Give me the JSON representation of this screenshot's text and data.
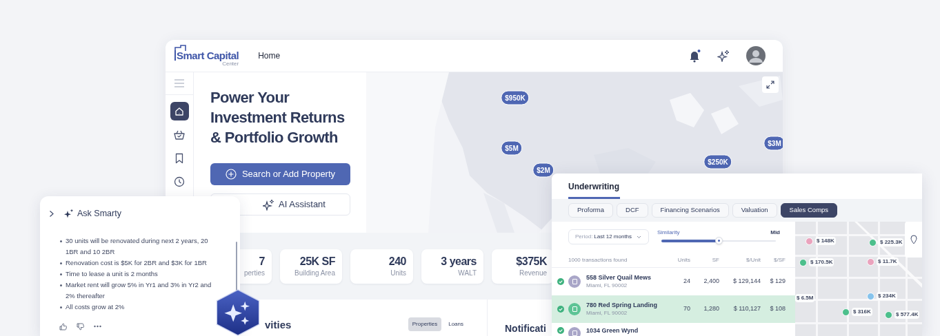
{
  "app": {
    "logo": {
      "name": "Smart Capital",
      "sub": "Center"
    },
    "page_title": "Home",
    "sidebar": [
      {
        "kind": "home",
        "selected": true
      },
      {
        "kind": "basket",
        "selected": false
      },
      {
        "kind": "bookmark",
        "selected": false
      },
      {
        "kind": "clock",
        "selected": false
      }
    ],
    "hero": {
      "title_lines": [
        "Power Your",
        "Investment Returns",
        "& Portfolio Growth"
      ],
      "primary_button": "Search or Add Property",
      "secondary_button": "AI Assistant"
    },
    "map_pins": [
      {
        "label": "$950K"
      },
      {
        "label": "$5M"
      },
      {
        "label": "$2M"
      },
      {
        "label": "$250K"
      },
      {
        "label": "$3M"
      }
    ],
    "stats": [
      {
        "value": "7",
        "label": "perties"
      },
      {
        "value": "25K SF",
        "label": "Building Area"
      },
      {
        "value": "240",
        "label": "Units"
      },
      {
        "value": "3 years",
        "label": "WALT"
      },
      {
        "value": "$375K",
        "label": "Revenue"
      }
    ],
    "activities": {
      "title": "vities",
      "filters": [
        {
          "label": "Properties",
          "selected": true
        },
        {
          "label": "Loans",
          "selected": false
        }
      ]
    },
    "notifications": {
      "title": "Notificati"
    }
  },
  "ask_smarty": {
    "title": "Ask Smarty",
    "bullets": [
      "30 units will be renovated during next 2 years, 20 1BR and 10 2BR",
      "Renovation cost is $5K for 2BR and $3K for 1BR",
      "Time to lease a unit is 2 months",
      "Market rent will grow 5% in Yr1 and 3% in Yr2 and 2% thereafter",
      "All costs grow at 2%"
    ]
  },
  "underwriting": {
    "title": "Underwriting",
    "tabs": [
      {
        "label": "Proforma",
        "selected": false
      },
      {
        "label": "DCF",
        "selected": false
      },
      {
        "label": "Financing Scenarios",
        "selected": false
      },
      {
        "label": "Valuation",
        "selected": false
      },
      {
        "label": "Sales Comps",
        "selected": true
      }
    ],
    "period": {
      "label": "Period:",
      "value": "Last 12 months"
    },
    "similarity": {
      "label": "Similarity",
      "reading": "Mid",
      "level": 0.5
    },
    "columns": [
      "1000 transactions found",
      "Units",
      "SF",
      "$/Unit",
      "$/SF"
    ],
    "rows": [
      {
        "name": "558 Silver Quail Mews",
        "address": "Miami, FL 90002",
        "units": "24",
        "sf": "2,400",
        "per_unit": "$ 129,144",
        "per_sf": "$ 129",
        "checked": true,
        "selected": false,
        "color": "#a9a6c8"
      },
      {
        "name": "780 Red Spring Landing",
        "address": "Miami, FL 90002",
        "units": "70",
        "sf": "1,280",
        "per_unit": "$ 110,127",
        "per_sf": "$ 108",
        "checked": true,
        "selected": true,
        "color": "#5cc495"
      },
      {
        "name": "1034 Green Wynd",
        "checked": true,
        "selected": false,
        "color": "#a9a6c8"
      }
    ],
    "comp_pins": [
      {
        "label": "$ 148K",
        "color": "#eaa3bd"
      },
      {
        "label": "$ 225.3K",
        "color": "#4cbf8c"
      },
      {
        "label": "$ 170.5K",
        "color": "#4cbf8c"
      },
      {
        "label": "$ 11.7K",
        "color": "#eaa3bd"
      },
      {
        "label": "$ 6.5M"
      },
      {
        "label": "$ 234K",
        "color": "#86c3ec"
      },
      {
        "label": "$ 316K",
        "color": "#4cbf8c"
      },
      {
        "label": "$ 577.4K",
        "color": "#4cbf8c"
      }
    ]
  }
}
